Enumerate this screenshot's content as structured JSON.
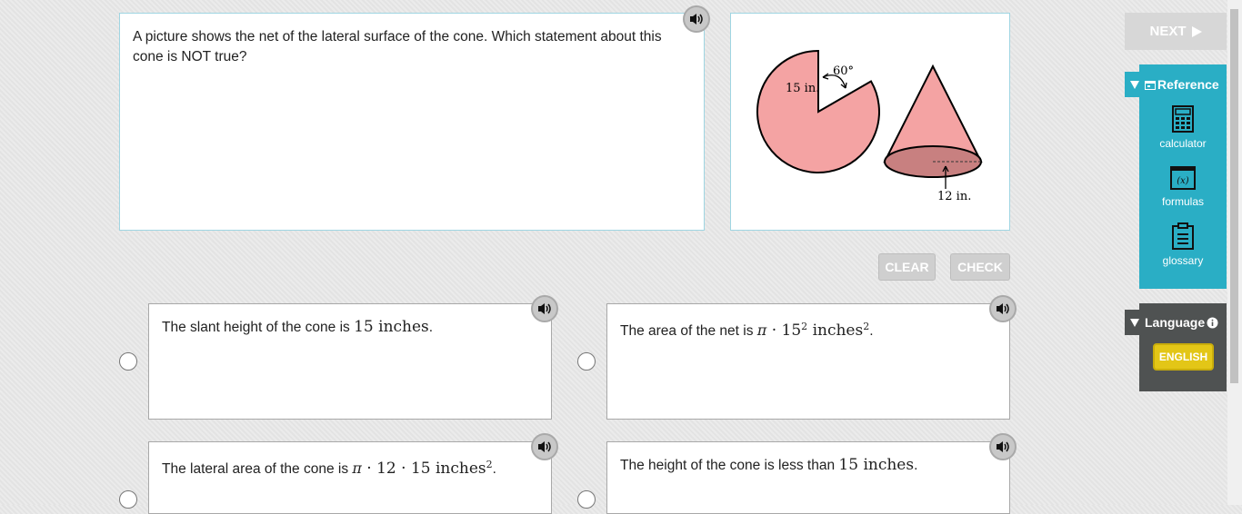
{
  "question": {
    "text": "A picture shows the net of the lateral surface of the cone. Which statement about this cone is NOT true?"
  },
  "figure": {
    "sector_label": "15 in.",
    "angle_label": "60°",
    "radius_label": "12 in.",
    "colors": {
      "fill": "#f4a3a3",
      "base": "#c88080",
      "stroke": "#000000"
    }
  },
  "buttons": {
    "clear": "CLEAR",
    "check": "CHECK",
    "next": "NEXT"
  },
  "answers": [
    {
      "pre": "The slant height of the cone is ",
      "math": "15 inches",
      "post": "."
    },
    {
      "pre": "The area of the net is ",
      "pi": "π",
      "dot": " · ",
      "base": "15",
      "sup": "2",
      "unit": " inches",
      "unit_sup": "2",
      "post": "."
    },
    {
      "pre": "The lateral area of the cone is ",
      "pi": "π",
      "math": " · 12 · 15 inches",
      "unit_sup": "2",
      "post": "."
    },
    {
      "pre": "The height of the cone is less than ",
      "math": "15 inches",
      "post": "."
    }
  ],
  "sidebar": {
    "reference_label": "Reference",
    "tools": [
      {
        "label": "calculator",
        "icon": "calculator-icon"
      },
      {
        "label": "formulas",
        "icon": "formulas-icon",
        "icon_text": "(x)"
      },
      {
        "label": "glossary",
        "icon": "glossary-icon"
      }
    ],
    "language_label": "Language",
    "language_button": "ENGLISH"
  },
  "colors": {
    "accent": "#2aaec5",
    "language_bg": "#4f5252",
    "english": "#e3c617",
    "card_border": "#9fd5e2"
  }
}
